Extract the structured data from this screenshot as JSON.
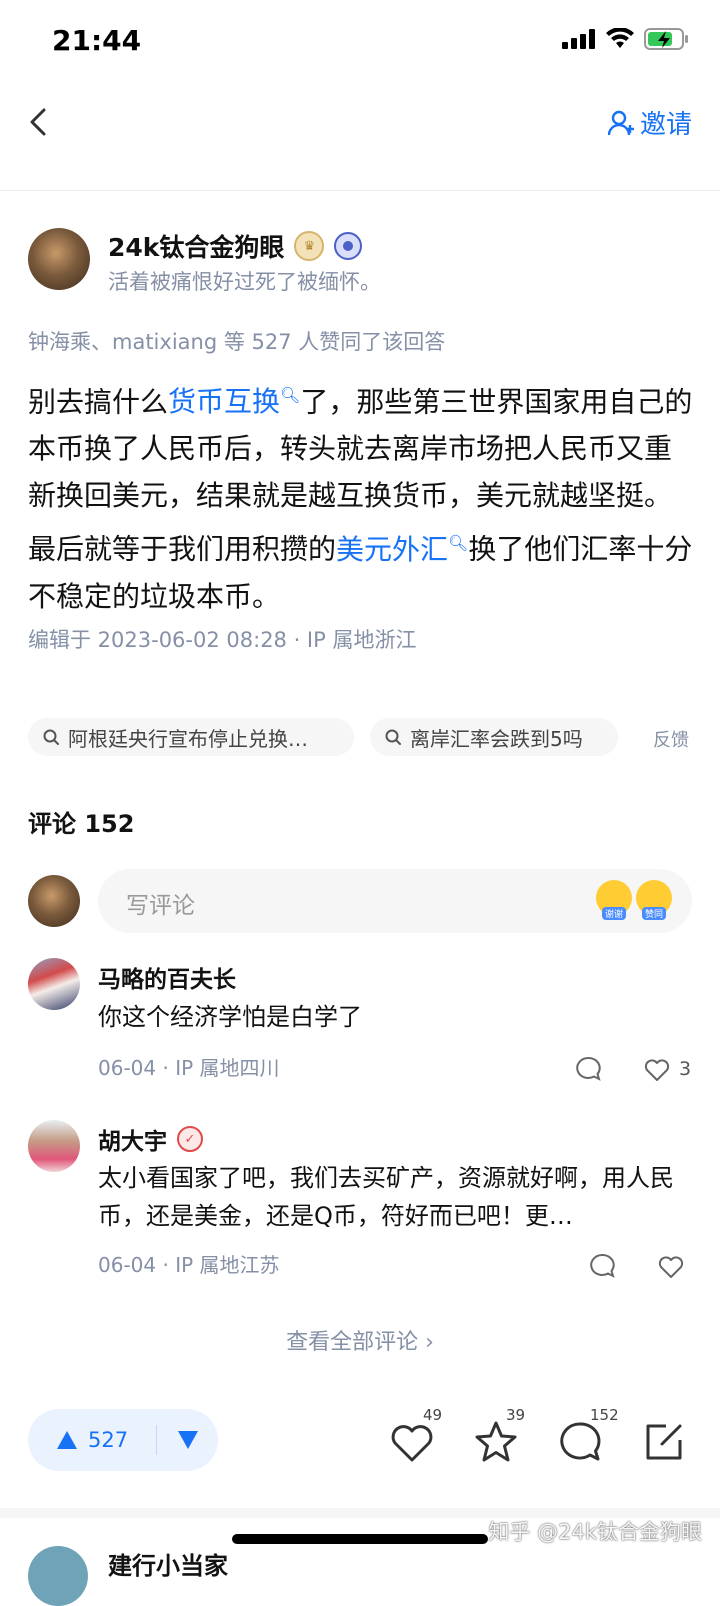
{
  "status_bar": {
    "time": "21:44"
  },
  "nav": {
    "invite_label": "邀请"
  },
  "author": {
    "name": "24k钛合金狗眼",
    "bio": "活着被痛恨好过死了被缅怀。"
  },
  "upvoters_text": "钟海乘、matixiang 等 527 人赞同了该回答",
  "answer": {
    "p1": "别去搞什么",
    "link1": "货币互换",
    "p2": "了，那些第三世界国家用自己的本币换了人民币后，转头就去离岸市场把人民币又重新换回美元，结果就是越互换货币，美元就越坚挺。最后就等于我们用积攒的",
    "link2": "美元外汇",
    "p3": "换了他们汇率十分不稳定的垃圾本币。"
  },
  "edit_info": "编辑于 2023-06-02 08:28 · IP 属地浙江",
  "related": {
    "chip1": "阿根廷央行宣布停止兑换…",
    "chip2": "离岸汇率会跌到5吗",
    "feedback": "反馈"
  },
  "comments": {
    "title": "评论 152",
    "input_placeholder": "写评论",
    "emoji1_label": "谢谢",
    "emoji2_label": "赞同",
    "items": [
      {
        "name": "马略的百夫长",
        "text": "你这个经济学怕是白学了",
        "date": "06-04",
        "location": "IP 属地四川",
        "likes": "3"
      },
      {
        "name": "胡大宇",
        "text": "太小看国家了吧，我们去买矿产，资源就好啊，用人民币，还是美金，还是Q币，符好而已吧！更…",
        "date": "06-04",
        "location": "IP 属地江苏",
        "likes": ""
      }
    ],
    "view_all": "查看全部评论 ›"
  },
  "bottom_bar": {
    "upvote_count": "527",
    "like_count": "49",
    "favorite_count": "39",
    "comment_count": "152",
    "accent": "#1772f6"
  },
  "next_answer": {
    "name": "建行小当家"
  },
  "watermark": "知乎 @24k钛合金狗眼"
}
